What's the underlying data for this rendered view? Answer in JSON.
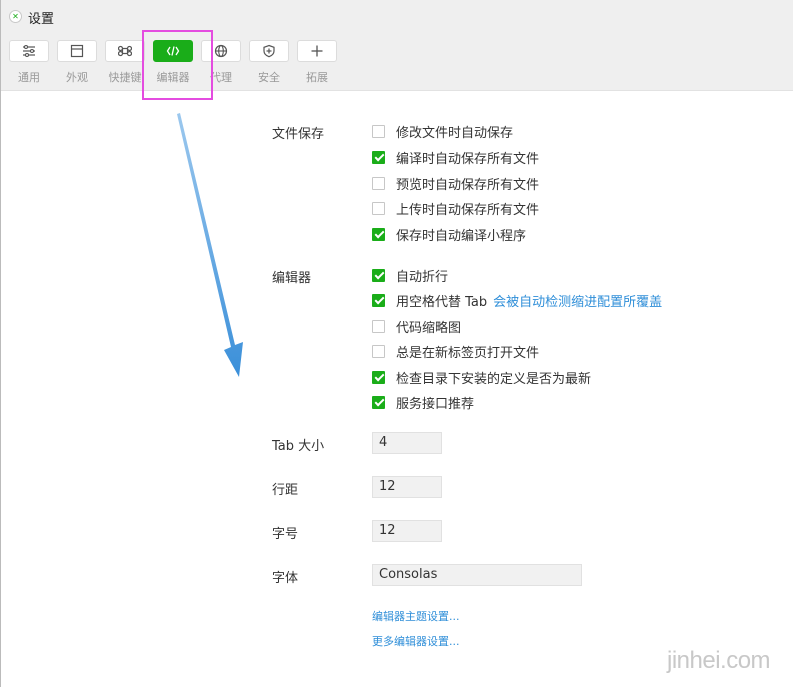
{
  "window": {
    "title": "设置"
  },
  "toolbar": {
    "items": [
      {
        "label": "通用",
        "icon": "sliders-icon"
      },
      {
        "label": "外观",
        "icon": "window-icon"
      },
      {
        "label": "快捷键",
        "icon": "command-icon"
      },
      {
        "label": "编辑器",
        "icon": "code-icon"
      },
      {
        "label": "代理",
        "icon": "globe-icon"
      },
      {
        "label": "安全",
        "icon": "shield-icon"
      },
      {
        "label": "拓展",
        "icon": "plus-icon"
      }
    ],
    "active_index": 3,
    "accent_color": "#1aad19",
    "highlight_color": "#e44ce0",
    "arrow_color": "#3a8fd9"
  },
  "file_save": {
    "label": "文件保存",
    "options": [
      {
        "text": "修改文件时自动保存",
        "checked": false
      },
      {
        "text": "编译时自动保存所有文件",
        "checked": true
      },
      {
        "text": "预览时自动保存所有文件",
        "checked": false
      },
      {
        "text": "上传时自动保存所有文件",
        "checked": false
      },
      {
        "text": "保存时自动编译小程序",
        "checked": true
      }
    ]
  },
  "editor": {
    "label": "编辑器",
    "options": [
      {
        "text": "自动折行",
        "checked": true
      },
      {
        "text": "用空格代替 Tab",
        "checked": true,
        "hint": "会被自动检测缩进配置所覆盖"
      },
      {
        "text": "代码缩略图",
        "checked": false
      },
      {
        "text": "总是在新标签页打开文件",
        "checked": false
      },
      {
        "text": "检查目录下安装的定义是否为最新",
        "checked": true
      },
      {
        "text": "服务接口推荐",
        "checked": true
      }
    ]
  },
  "fields": {
    "tab_size": {
      "label": "Tab 大小",
      "value": "4"
    },
    "line_height": {
      "label": "行距",
      "value": "12"
    },
    "font_size": {
      "label": "字号",
      "value": "12"
    },
    "font_family": {
      "label": "字体",
      "value": "Consolas"
    }
  },
  "links": {
    "theme": "编辑器主题设置...",
    "more": "更多编辑器设置..."
  },
  "watermark": "jinhei.com"
}
